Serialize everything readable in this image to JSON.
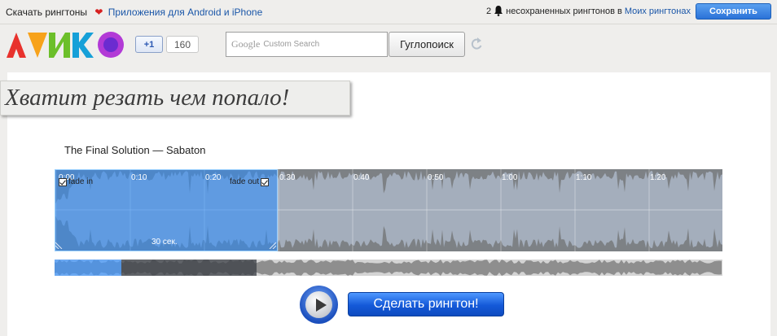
{
  "topbar": {
    "download_link": "Скачать рингтоны",
    "apps_link": "Приложения для Android и iPhone",
    "unsaved_count": "2",
    "unsaved_text": "несохраненных рингтонов в",
    "my_ringtones_link": "Моих рингтонах",
    "save_button": "Сохранить",
    "icons": [
      "heart-icon",
      "bell-icon"
    ]
  },
  "header": {
    "gplus_label": "+1",
    "gplus_count": "160",
    "search_brand": "Google",
    "search_placeholder": "Custom Search",
    "search_button": "Гуглопоиск",
    "icons": [
      "logo",
      "refresh-icon"
    ]
  },
  "banner": {
    "text": "Хватит резать чем попало!"
  },
  "editor": {
    "track_title": "The Final Solution — Sabaton",
    "time_ticks": [
      "0:10",
      "0:20",
      "0:30",
      "0:40",
      "0:50",
      "1:00",
      "1:10",
      "1:20"
    ],
    "fade_in_label": "fade in",
    "fade_out_label": "fade out",
    "fade_in_checked": true,
    "fade_out_checked": true,
    "selection_duration": "30 сек."
  },
  "actions": {
    "make_button": "Сделать рингтон!"
  },
  "colors": {
    "accent": "#2a72d8",
    "selection": "#3d95ff",
    "waveform": "#7d8185"
  }
}
